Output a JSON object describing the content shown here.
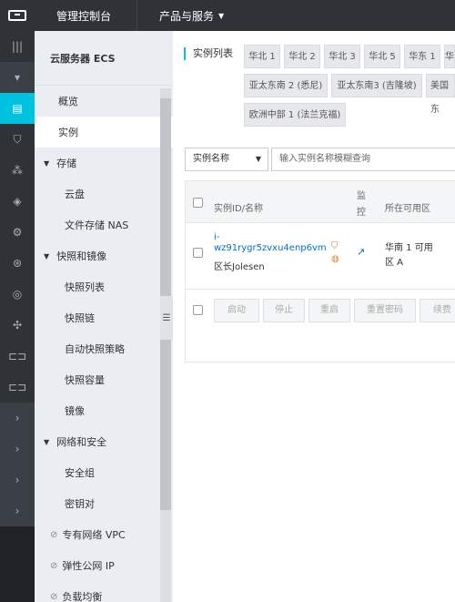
{
  "topbar": {
    "console": "管理控制台",
    "products": "产品与服务"
  },
  "sidebar": {
    "title": "云服务器 ECS",
    "items": [
      {
        "label": "概览",
        "kind": "l1"
      },
      {
        "label": "实例",
        "kind": "l1",
        "active": true
      },
      {
        "label": "存储",
        "kind": "grp"
      },
      {
        "label": "云盘",
        "kind": "l2"
      },
      {
        "label": "文件存储 NAS",
        "kind": "l2"
      },
      {
        "label": "快照和镜像",
        "kind": "grp"
      },
      {
        "label": "快照列表",
        "kind": "l2"
      },
      {
        "label": "快照链",
        "kind": "l2"
      },
      {
        "label": "自动快照策略",
        "kind": "l2"
      },
      {
        "label": "快照容量",
        "kind": "l2"
      },
      {
        "label": "镜像",
        "kind": "l2"
      },
      {
        "label": "网络和安全",
        "kind": "grp"
      },
      {
        "label": "安全组",
        "kind": "l2"
      },
      {
        "label": "密钥对",
        "kind": "l2"
      },
      {
        "label": "专有网络 VPC",
        "kind": "link"
      },
      {
        "label": "弹性公网 IP",
        "kind": "link"
      },
      {
        "label": "负载均衡",
        "kind": "link"
      }
    ]
  },
  "main": {
    "instance_list_label": "实例列表",
    "regions": [
      "华北 1",
      "华北 2",
      "华北 3",
      "华北 5",
      "华东 1",
      "华东",
      "亚太东南 2 (悉尼)",
      "亚太东南3 (吉隆坡)",
      "美国东",
      "欧洲中部 1 (法兰克福)"
    ],
    "filter": {
      "select": "实例名称",
      "placeholder": "输入实例名称模糊查询"
    },
    "table": {
      "headers": {
        "id_name": "实例ID/名称",
        "monitor": "监控",
        "zone": "所在可用区"
      },
      "row": {
        "id_line1": "i-",
        "id_line2": "wz91rygr5zvxu4enp6vm",
        "name": "区长Jolesen",
        "zone_line1": "华南 1 可用",
        "zone_line2": "区 A"
      }
    },
    "actions": [
      "启动",
      "停止",
      "重启",
      "重置密码",
      "续费"
    ]
  }
}
